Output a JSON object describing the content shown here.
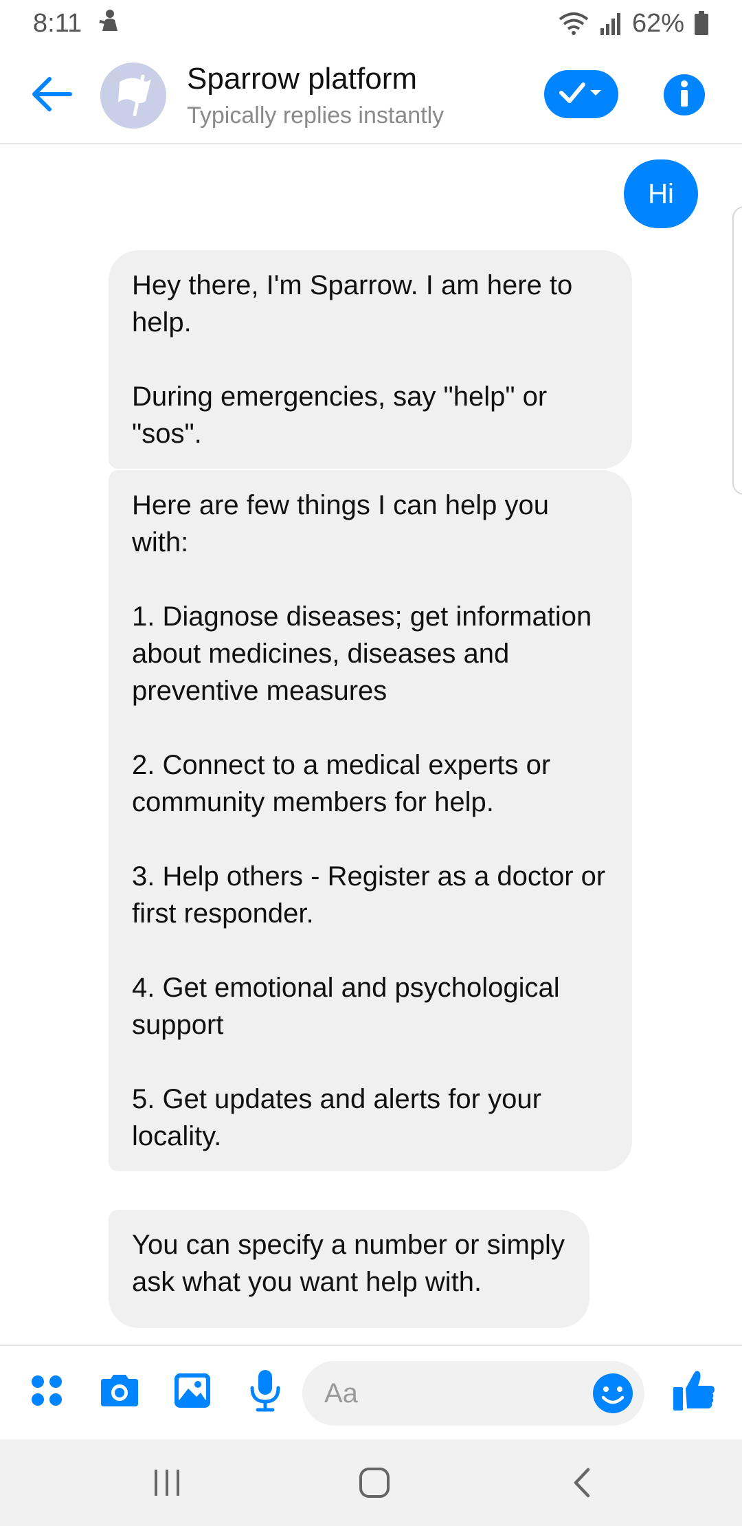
{
  "status_bar": {
    "time": "8:11",
    "battery": "62%"
  },
  "header": {
    "title": "Sparrow platform",
    "subtitle": "Typically replies instantly",
    "icons": {
      "back": "arrow-left-icon",
      "avatar": "flag-icon",
      "check": "check-dropdown-icon",
      "info": "info-icon"
    },
    "accent_color": "#0084ff"
  },
  "messages": [
    {
      "sender": "user",
      "text": "Hi"
    },
    {
      "sender": "bot",
      "text": "Hey there, I'm Sparrow. I am here to help.\n\nDuring emergencies, say \"help\" or \"sos\"."
    },
    {
      "sender": "bot",
      "text": "Here are few things I can help you with:\n\n1. Diagnose diseases; get information about medicines, diseases and preventive measures\n\n2. Connect to a medical experts or community members for help.\n\n3. Help others - Register as a doctor or first responder.\n\n4. Get emotional and psychological support\n\n5. Get updates and alerts for your locality."
    },
    {
      "sender": "bot",
      "text": "You can specify a number or simply ask what you want help with."
    }
  ],
  "composer": {
    "placeholder": "Aa",
    "icons": [
      "apps-icon",
      "camera-icon",
      "gallery-icon",
      "microphone-icon",
      "emoji-icon",
      "thumbs-up-icon"
    ]
  },
  "navbar": {
    "icons": [
      "recent-apps-icon",
      "home-icon",
      "back-icon"
    ]
  }
}
